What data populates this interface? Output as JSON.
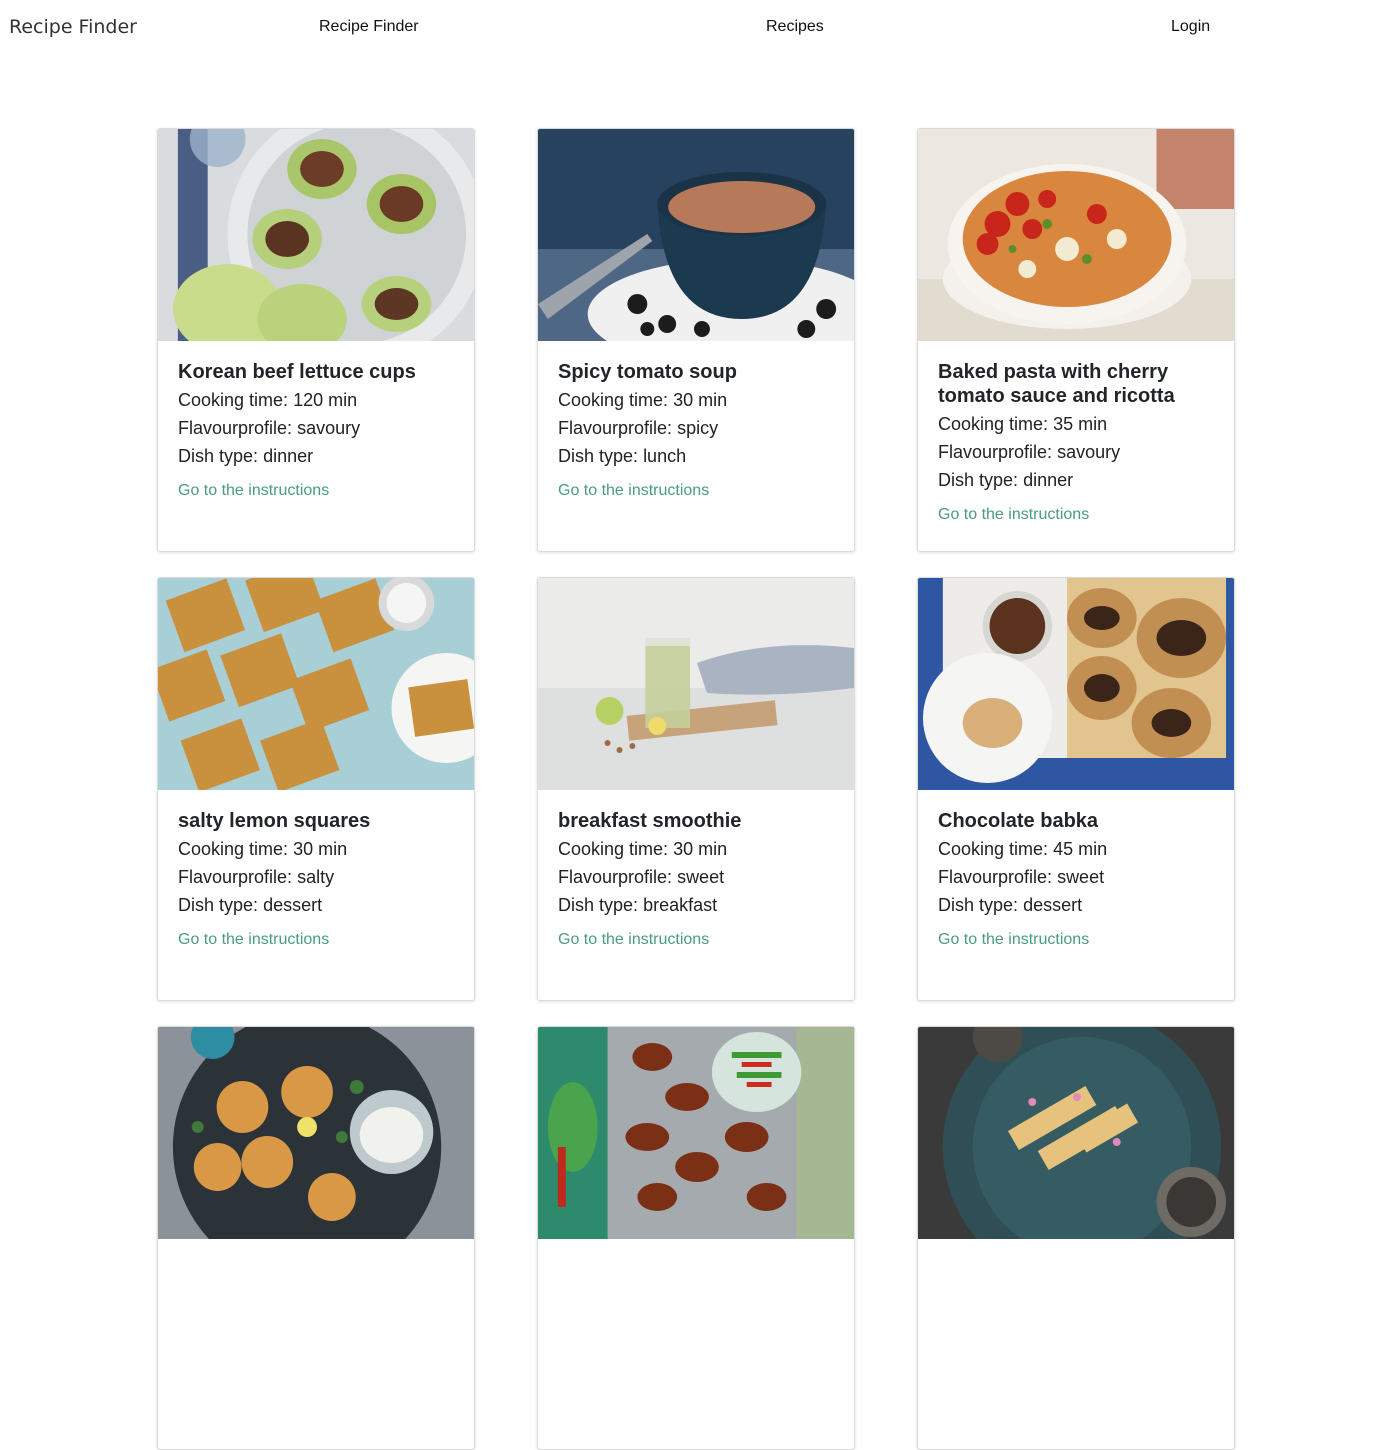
{
  "navbar": {
    "brand": "Recipe Finder",
    "links": [
      "Recipe Finder",
      "Recipes",
      "Login"
    ]
  },
  "labels": {
    "cooking_time": "Cooking time:",
    "flavour": "Flavourprofile:",
    "dish_type": "Dish type:",
    "link": "Go to the instructions"
  },
  "recipes": [
    {
      "title": "Korean beef lettuce cups",
      "cooking_time": "120 min",
      "flavour": "savoury",
      "dish_type": "dinner"
    },
    {
      "title": "Spicy tomato soup",
      "cooking_time": "30 min",
      "flavour": "spicy",
      "dish_type": "lunch"
    },
    {
      "title": "Baked pasta with cherry tomato sauce and ricotta",
      "cooking_time": "35 min",
      "flavour": "savoury",
      "dish_type": "dinner"
    },
    {
      "title": "salty lemon squares",
      "cooking_time": "30 min",
      "flavour": "salty",
      "dish_type": "dessert"
    },
    {
      "title": "breakfast smoothie",
      "cooking_time": "30 min",
      "flavour": "sweet",
      "dish_type": "breakfast"
    },
    {
      "title": "Chocolate babka",
      "cooking_time": "45 min",
      "flavour": "sweet",
      "dish_type": "dessert"
    }
  ],
  "colors": {
    "link": "#4a9b7f",
    "card_border": "#dadada"
  }
}
